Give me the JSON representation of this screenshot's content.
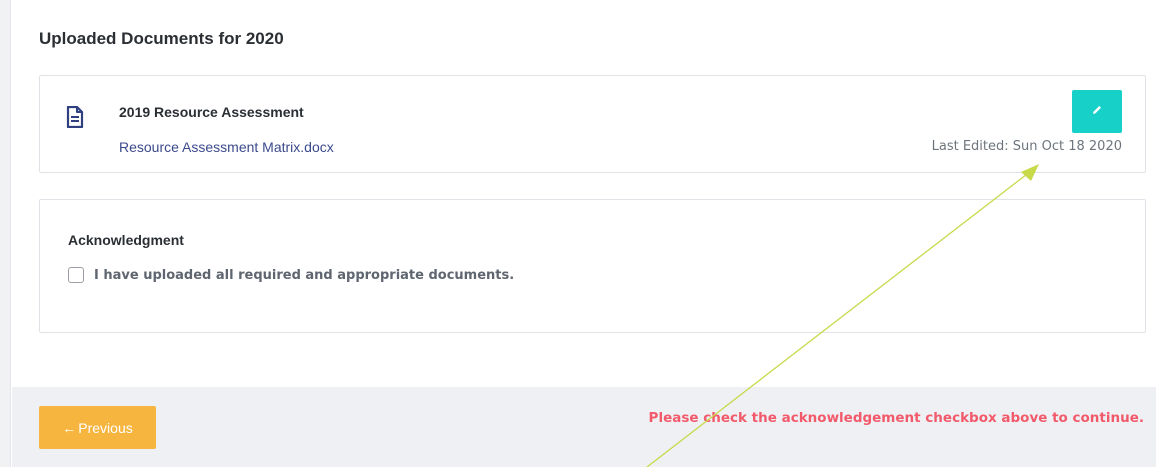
{
  "section": {
    "title": "Uploaded Documents for 2020"
  },
  "document": {
    "title": "2019 Resource Assessment",
    "file_name": "Resource Assessment Matrix.docx",
    "last_edited": "Last Edited: Sun Oct 18 2020",
    "icon": "document-icon",
    "edit_icon": "pencil-icon"
  },
  "acknowledgment": {
    "title": "Acknowledgment",
    "checkbox_label": "I have uploaded all required and appropriate documents.",
    "checked": false
  },
  "footer": {
    "previous_label": "Previous",
    "previous_icon": "arrow-left-icon",
    "warning": "Please check the acknowledgement checkbox above to continue."
  },
  "colors": {
    "edit_button": "#17d1c9",
    "previous_button": "#f6b53f",
    "warning": "#f25a6b",
    "link": "#3b4a8c",
    "annotation_line": "#c8d94a"
  }
}
